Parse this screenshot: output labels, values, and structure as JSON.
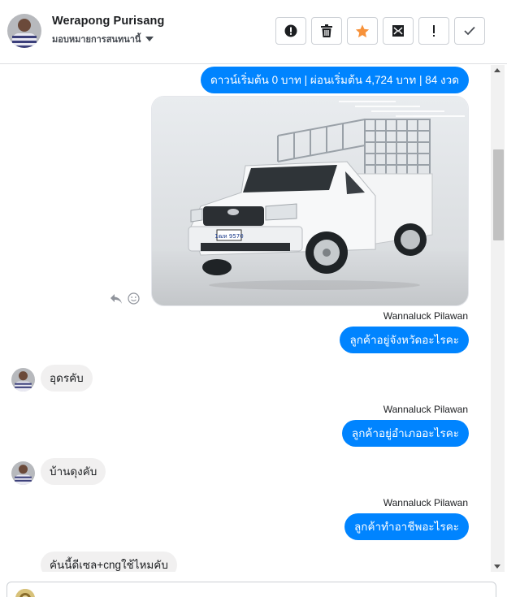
{
  "header": {
    "contact_name": "Werapong Purisang",
    "assign_label": "มอบหมายการสนทนานี้",
    "actions": [
      {
        "name": "mark-spam-button",
        "icon": "alert-circle-icon"
      },
      {
        "name": "delete-button",
        "icon": "trash-icon"
      },
      {
        "name": "star-button",
        "icon": "star-icon"
      },
      {
        "name": "mark-unread-button",
        "icon": "envelope-icon"
      },
      {
        "name": "follow-up-button",
        "icon": "exclamation-icon"
      },
      {
        "name": "mark-done-button",
        "icon": "check-icon"
      }
    ]
  },
  "messages": {
    "m1": "ดาวน์เริ่มต้น 0 บาท | ผ่อนเริ่มต้น 4,724 บาท | 84 งวด",
    "sender1": "Wannaluck Pilawan",
    "m2": "ลูกค้าอยู่จังหวัดอะไรคะ",
    "m3": "อุดรคับ",
    "sender2": "Wannaluck Pilawan",
    "m4": "ลูกค้าอยู่อำเภออะไรคะ",
    "m5": "บ้านดุงคับ",
    "sender3": "Wannaluck Pilawan",
    "m6": "ลูกค้าทำอาชีพอะไรคะ",
    "m7": "คันนี้ดีเซล+cngใช้ไหมคับ"
  },
  "photo": {
    "plate_text": "1ฒห 9570"
  },
  "colors": {
    "outgoing_bubble": "#0084ff",
    "incoming_bubble": "#f1f0f0",
    "star": "#f7923a"
  }
}
